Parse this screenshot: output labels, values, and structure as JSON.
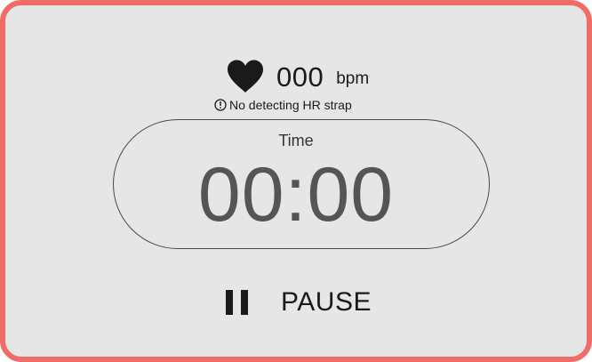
{
  "heart_rate": {
    "icon": "heart-icon",
    "value": "000",
    "unit": "bpm",
    "warning_icon": "info-circle-icon",
    "warning_text": "No detecting HR strap"
  },
  "timer": {
    "label": "Time",
    "value": "00:00"
  },
  "controls": {
    "pause_icon": "pause-icon",
    "pause_label": "PAUSE"
  },
  "colors": {
    "border": "#ef6d66",
    "background": "#e6e6e6",
    "timer_text": "#555555"
  }
}
